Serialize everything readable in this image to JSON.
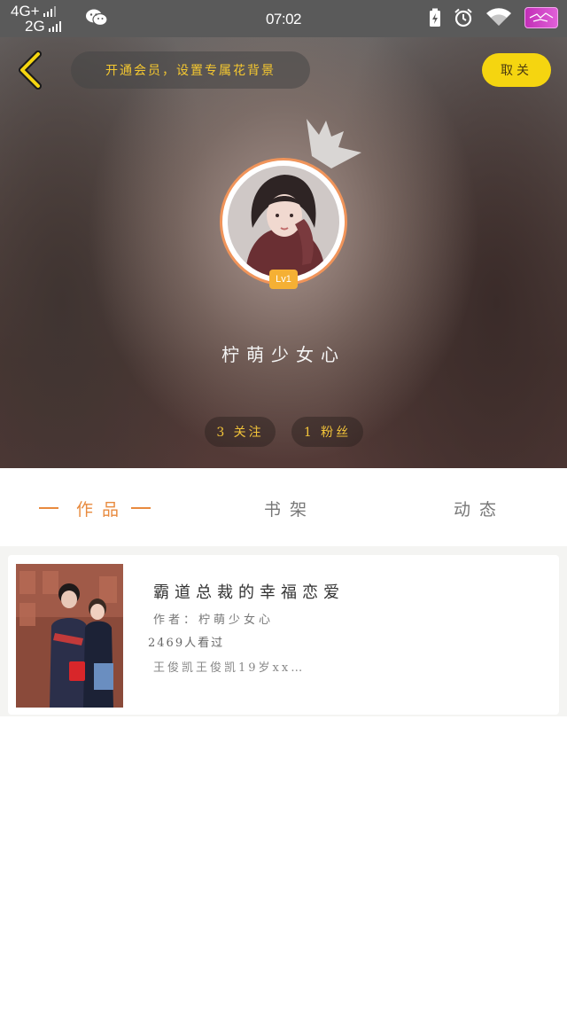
{
  "status_bar": {
    "network_top": "4G+",
    "network_bottom": "2G",
    "time": "07:02"
  },
  "header": {
    "vip_banner": "开通会员，设置专属花背景",
    "follow_button": "取关"
  },
  "profile": {
    "level": "Lv1",
    "username": "柠萌少女心",
    "following_label": "3 关注",
    "fans_label": "1 粉丝"
  },
  "tabs": [
    {
      "label": "作品"
    },
    {
      "label": "书架"
    },
    {
      "label": "动态"
    }
  ],
  "book": {
    "title": "霸道总裁的幸福恋爱",
    "author": "作者：柠萌少女心",
    "reads": "2469人看过",
    "description": "王俊凯王俊凯19岁xx…"
  },
  "colors": {
    "accent_orange": "#e88a3e",
    "accent_yellow": "#f5d510",
    "stat_text": "#f2c43a"
  }
}
